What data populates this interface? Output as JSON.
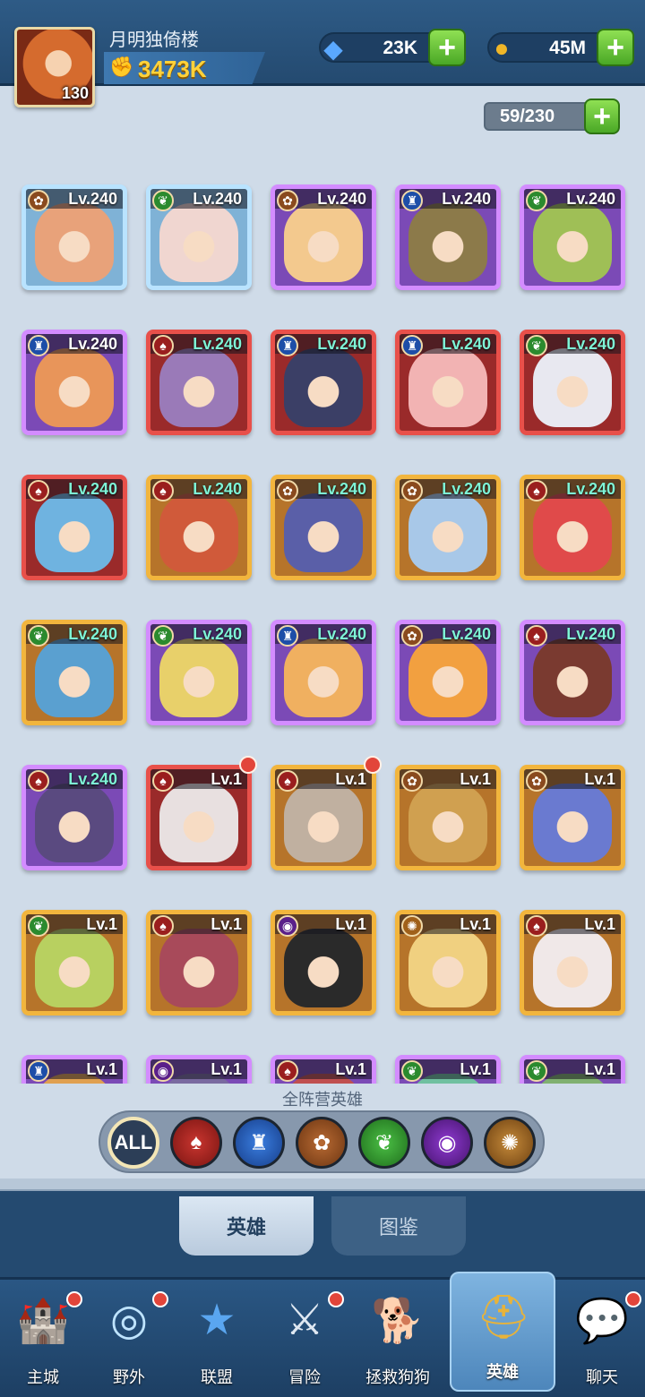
{
  "player": {
    "name": "月明独倚楼",
    "level": "130",
    "power": "3473K"
  },
  "resources": {
    "gems": "23K",
    "gold": "45M",
    "hero_capacity": "59/230"
  },
  "icons": {
    "gem": "diamond-icon",
    "gold": "coin-icon",
    "power": "fist-icon",
    "plus": "plus-icon"
  },
  "heroes": [
    {
      "level": "Lv.240",
      "faction": "beast",
      "rarity": "blue"
    },
    {
      "level": "Lv.240",
      "faction": "nature",
      "rarity": "blue"
    },
    {
      "level": "Lv.240",
      "faction": "beast",
      "rarity": "purple"
    },
    {
      "level": "Lv.240",
      "faction": "league",
      "rarity": "purple"
    },
    {
      "level": "Lv.240",
      "faction": "nature",
      "rarity": "purple"
    },
    {
      "level": "Lv.240",
      "faction": "league",
      "rarity": "purple"
    },
    {
      "level": "Lv.240",
      "faction": "horde",
      "rarity": "red"
    },
    {
      "level": "Lv.240",
      "faction": "league",
      "rarity": "red"
    },
    {
      "level": "Lv.240",
      "faction": "league",
      "rarity": "red"
    },
    {
      "level": "Lv.240",
      "faction": "nature",
      "rarity": "red"
    },
    {
      "level": "Lv.240",
      "faction": "horde",
      "rarity": "red"
    },
    {
      "level": "Lv.240",
      "faction": "horde",
      "rarity": "gold"
    },
    {
      "level": "Lv.240",
      "faction": "beast",
      "rarity": "gold"
    },
    {
      "level": "Lv.240",
      "faction": "beast",
      "rarity": "gold"
    },
    {
      "level": "Lv.240",
      "faction": "horde",
      "rarity": "gold"
    },
    {
      "level": "Lv.240",
      "faction": "nature",
      "rarity": "gold"
    },
    {
      "level": "Lv.240",
      "faction": "nature",
      "rarity": "purple"
    },
    {
      "level": "Lv.240",
      "faction": "league",
      "rarity": "purple"
    },
    {
      "level": "Lv.240",
      "faction": "beast",
      "rarity": "purple"
    },
    {
      "level": "Lv.240",
      "faction": "horde",
      "rarity": "purple"
    },
    {
      "level": "Lv.240",
      "faction": "horde",
      "rarity": "purple"
    },
    {
      "level": "Lv.1",
      "faction": "horde",
      "rarity": "red",
      "badge": true
    },
    {
      "level": "Lv.1",
      "faction": "horde",
      "rarity": "gold",
      "badge": true
    },
    {
      "level": "Lv.1",
      "faction": "beast",
      "rarity": "gold"
    },
    {
      "level": "Lv.1",
      "faction": "beast",
      "rarity": "gold"
    },
    {
      "level": "Lv.1",
      "faction": "nature",
      "rarity": "gold"
    },
    {
      "level": "Lv.1",
      "faction": "horde",
      "rarity": "gold"
    },
    {
      "level": "Lv.1",
      "faction": "shadow",
      "rarity": "gold"
    },
    {
      "level": "Lv.1",
      "faction": "light",
      "rarity": "gold"
    },
    {
      "level": "Lv.1",
      "faction": "horde",
      "rarity": "gold"
    },
    {
      "level": "Lv.1",
      "faction": "league",
      "rarity": "purple"
    },
    {
      "level": "Lv.1",
      "faction": "shadow",
      "rarity": "purple"
    },
    {
      "level": "Lv.1",
      "faction": "horde",
      "rarity": "purple"
    },
    {
      "level": "Lv.1",
      "faction": "nature",
      "rarity": "purple"
    },
    {
      "level": "Lv.1",
      "faction": "nature",
      "rarity": "purple"
    }
  ],
  "filter": {
    "title": "全阵营英雄",
    "all_label": "ALL",
    "buttons": [
      "horde",
      "league",
      "beast",
      "nature",
      "shadow",
      "light"
    ]
  },
  "tabs": {
    "heroes": "英雄",
    "codex": "图鉴"
  },
  "nav": [
    {
      "label": "主城",
      "icon": "castle-icon",
      "badge": true
    },
    {
      "label": "野外",
      "icon": "portal-icon",
      "badge": true
    },
    {
      "label": "联盟",
      "icon": "shield-star-icon",
      "badge": false
    },
    {
      "label": "冒险",
      "icon": "sword-icon",
      "badge": true
    },
    {
      "label": "拯救狗狗",
      "icon": "dog-icon",
      "badge": false
    },
    {
      "label": "英雄",
      "icon": "helmet-icon",
      "badge": false,
      "active": true
    },
    {
      "label": "聊天",
      "icon": "chat-icon",
      "badge": true
    }
  ],
  "colors": {
    "accent_gold": "#ffd23a",
    "plus_green": "#5bbd2f",
    "badge_red": "#e2453a"
  }
}
